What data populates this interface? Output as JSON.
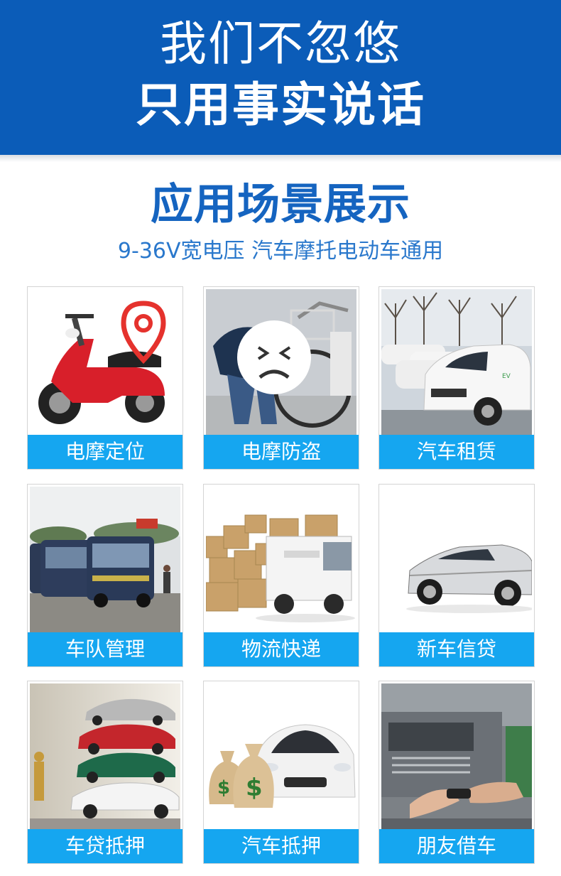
{
  "banner": {
    "line1": "我们不忽悠",
    "line2": "只用事实说话"
  },
  "section": {
    "title": "应用场景展示",
    "subtitle": "9-36V宽电压 汽车摩托电动车通用"
  },
  "colors": {
    "banner_bg": "#0b5cb8",
    "title_blue": "#1564c0",
    "label_bg": "#15a6f0",
    "label_text": "#ffffff"
  },
  "scenarios": [
    {
      "label": "电摩定位",
      "icon": "scooter-location-image"
    },
    {
      "label": "电摩防盗",
      "icon": "scooter-theft-image"
    },
    {
      "label": "汽车租赁",
      "icon": "car-rental-image"
    },
    {
      "label": "车队管理",
      "icon": "bus-fleet-image"
    },
    {
      "label": "物流快递",
      "icon": "logistics-truck-image"
    },
    {
      "label": "新车信贷",
      "icon": "new-car-image"
    },
    {
      "label": "车贷抵押",
      "icon": "car-stack-image"
    },
    {
      "label": "汽车抵押",
      "icon": "money-car-image"
    },
    {
      "label": "朋友借车",
      "icon": "car-key-handover-image"
    }
  ]
}
